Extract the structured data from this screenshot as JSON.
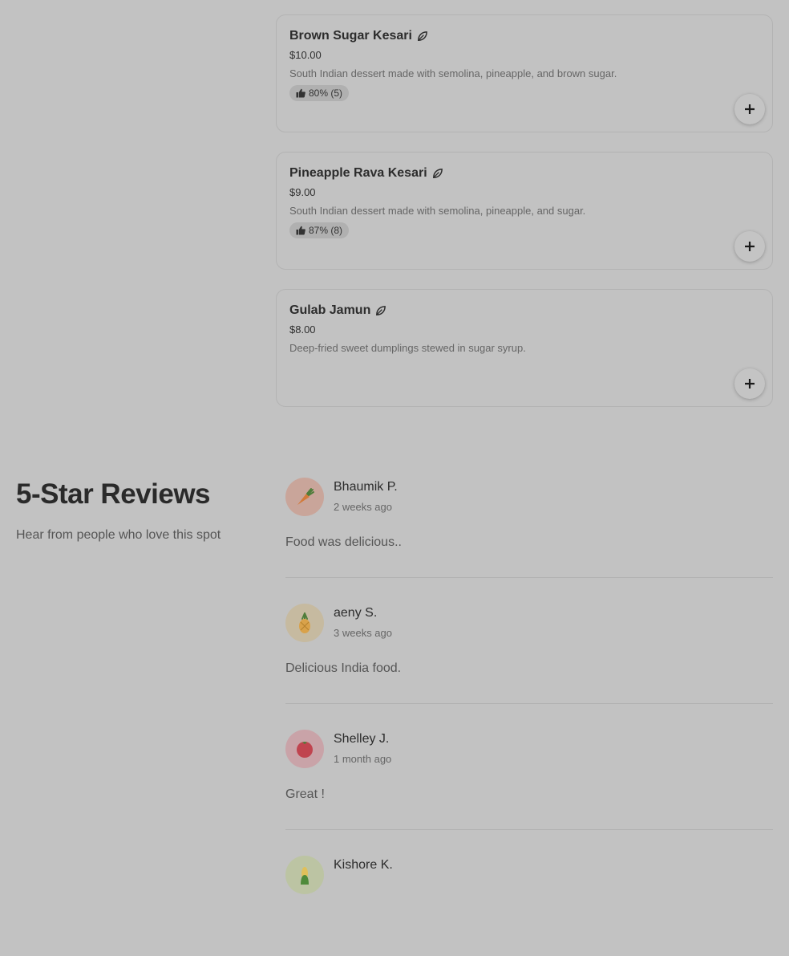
{
  "menu": {
    "items": [
      {
        "name": "Brown Sugar Kesari",
        "price": "$10.00",
        "description": "South Indian dessert made with semolina, pineapple, and brown sugar.",
        "rating": "80% (5)",
        "veg_icon": "leaf-icon"
      },
      {
        "name": "Pineapple Rava Kesari",
        "price": "$9.00",
        "description": "South Indian dessert made with semolina, pineapple, and sugar.",
        "rating": "87% (8)",
        "veg_icon": "leaf-icon"
      },
      {
        "name": "Gulab Jamun",
        "price": "$8.00",
        "description": "Deep-fried sweet dumplings stewed in sugar syrup.",
        "rating": "",
        "veg_icon": "leaf-icon"
      }
    ]
  },
  "reviews_section": {
    "title": "5-Star Reviews",
    "subtitle": "Hear from people who love this spot"
  },
  "reviews": [
    {
      "name": "Bhaumik P.",
      "date": "2 weeks ago",
      "text": "Food was delicious..",
      "avatar_icon": "carrot-icon",
      "avatar_color": "#c9a59a"
    },
    {
      "name": "aeny S.",
      "date": "3 weeks ago",
      "text": "Delicious India food.",
      "avatar_icon": "pineapple-icon",
      "avatar_color": "#c6baa0"
    },
    {
      "name": "Shelley J.",
      "date": "1 month ago",
      "text": "Great !",
      "avatar_icon": "tomato-icon",
      "avatar_color": "#c9a3a8"
    },
    {
      "name": "Kishore K.",
      "date": "",
      "text": "",
      "avatar_icon": "corn-icon",
      "avatar_color": "#bcc4a3"
    }
  ]
}
